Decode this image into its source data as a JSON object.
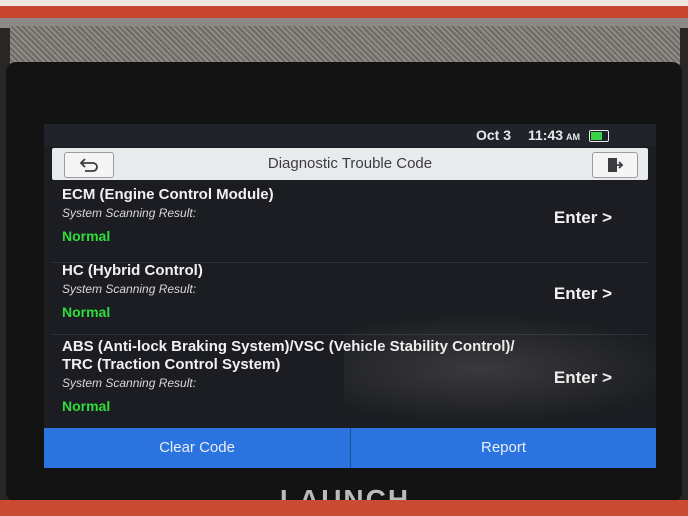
{
  "device": {
    "brand": "LAUNCH"
  },
  "status_bar": {
    "date": "Oct 3",
    "time": "11:43",
    "ampm": "AM"
  },
  "header": {
    "title": "Diagnostic Trouble Code"
  },
  "modules": [
    {
      "name": "ECM (Engine Control Module)",
      "scan_label": "System Scanning Result:",
      "result": "Normal",
      "action": "Enter >"
    },
    {
      "name": "HC (Hybrid Control)",
      "scan_label": "System Scanning Result:",
      "result": "Normal",
      "action": "Enter >"
    },
    {
      "name": "ABS (Anti-lock Braking System)/VSC (Vehicle Stability Control)/",
      "name_line2": "TRC (Traction Control System)",
      "scan_label": "System Scanning Result:",
      "result": "Normal",
      "action": "Enter >"
    }
  ],
  "footer": {
    "clear_label": "Clear Code",
    "report_label": "Report"
  },
  "colors": {
    "accent": "#2b74e0",
    "normal": "#2fdc3a",
    "casing": "#c8462e"
  }
}
